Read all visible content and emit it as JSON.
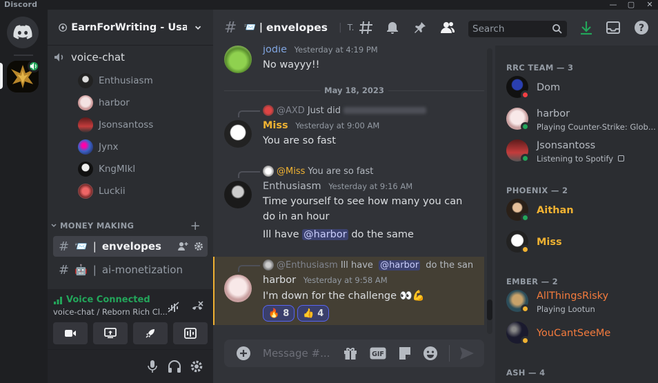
{
  "window": {
    "app_name": "Discord"
  },
  "server": {
    "name": "EarnForWriting - Usa/..."
  },
  "voice_channel": {
    "name": "voice-chat",
    "users": [
      "Enthusiasm",
      "harbor",
      "Jsonsantoss",
      "Jynx",
      "KngMIkl",
      "Luckii"
    ]
  },
  "category": {
    "name": "MONEY MAKING"
  },
  "text_channels": [
    {
      "name": "envelopes",
      "emoji": "📨",
      "active": true
    },
    {
      "name": "ai-monetization",
      "emoji": "🤖",
      "active": false
    }
  ],
  "voice_panel": {
    "status": "Voice Connected",
    "subtitle": "voice-chat / Reborn Rich Cl..."
  },
  "chat_header": {
    "channel": "envelopes",
    "emoji": "📨",
    "topic_initial": "T.",
    "search_placeholder": "Search"
  },
  "date_divider": "May 18, 2023",
  "messages": [
    {
      "author": "jodie",
      "author_color": "#80a5e0",
      "time": "Yesterday at 4:19 PM",
      "lines": [
        "No wayyy!!"
      ]
    },
    {
      "reply_to": "@AXD",
      "reply_text": "Just did",
      "author": "Miss",
      "author_color": "#f0b232",
      "time": "Yesterday at 9:00 AM",
      "lines": [
        "You are so fast"
      ]
    },
    {
      "reply_to": "@Miss",
      "reply_text": "You are so fast",
      "author": "Enthusiasm",
      "author_color": "#b5bac1",
      "time": "Yesterday at 9:16 AM",
      "lines": [
        "Time yourself to see how many you can",
        "do in an hour"
      ],
      "mention_line": {
        "before": "Ill have ",
        "mention": "@harbor",
        "after": " do the same"
      }
    },
    {
      "reply_to": "@Enthusiasm",
      "reply_text_before": "Ill have ",
      "reply_mention": "@harbor",
      "reply_text_after": " do the san",
      "author": "harbor",
      "author_color": "#dbdee1",
      "time": "Yesterday at 9:58 AM",
      "lines": [
        "I'm down for the challenge 👀💪"
      ],
      "reactions": [
        {
          "emoji": "🔥",
          "count": "8"
        },
        {
          "emoji": "👍",
          "count": "4"
        }
      ]
    }
  ],
  "composer": {
    "placeholder": "Message #..."
  },
  "members": {
    "groups": [
      {
        "label": "RRC TEAM — 3",
        "members": [
          {
            "name": "Dom",
            "color": "#b5bac1",
            "status": "dnd",
            "activity": ""
          },
          {
            "name": "harbor",
            "color": "#b5bac1",
            "status": "online",
            "activity": "Playing Counter-Strike: Glob..."
          },
          {
            "name": "Jsonsantoss",
            "color": "#b5bac1",
            "status": "online",
            "activity": "Listening to Spotify"
          }
        ]
      },
      {
        "label": "PHOENIX — 2",
        "members": [
          {
            "name": "Aithan",
            "color": "#f0b232",
            "status": "online",
            "activity": ""
          },
          {
            "name": "Miss",
            "color": "#f0b232",
            "status": "idle",
            "activity": ""
          }
        ]
      },
      {
        "label": "EMBER — 2",
        "members": [
          {
            "name": "AllThingsRisky",
            "color": "#f47b3d",
            "status": "idle",
            "activity": "Playing Lootun"
          },
          {
            "name": "YouCantSeeMe",
            "color": "#f47b3d",
            "status": "idle",
            "activity": ""
          }
        ]
      },
      {
        "label": "ASH — 4",
        "members": []
      }
    ]
  },
  "colors": {
    "online": "#23a55a",
    "idle": "#f0b232",
    "dnd": "#f23f43",
    "accent": "#5865f2"
  }
}
